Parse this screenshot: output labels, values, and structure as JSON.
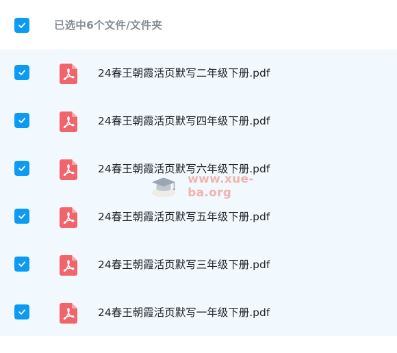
{
  "header": {
    "selection_text": "已选中6个文件/文件夹"
  },
  "files": [
    {
      "name": "24春王朝霞活页默写二年级下册.pdf"
    },
    {
      "name": "24春王朝霞活页默写四年级下册.pdf"
    },
    {
      "name": "24春王朝霞活页默写六年级下册.pdf"
    },
    {
      "name": "24春王朝霞活页默写五年级下册.pdf"
    },
    {
      "name": "24春王朝霞活页默写三年级下册.pdf"
    },
    {
      "name": "24春王朝霞活页默写一年级下册.pdf"
    }
  ],
  "watermark": {
    "text": "www.xue-ba.org"
  },
  "colors": {
    "accent": "#0d9bf2",
    "pdf_icon": "#f0656b",
    "list_background": "#f2f9fe"
  }
}
